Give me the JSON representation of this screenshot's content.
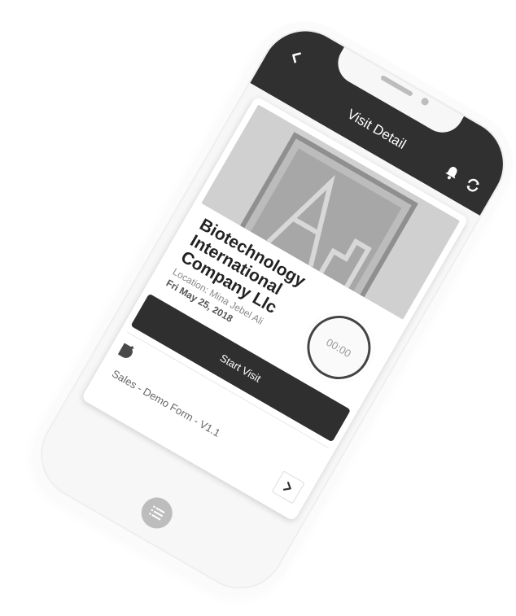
{
  "header": {
    "title": "Visit Detail",
    "back_icon": "chevron-left-icon",
    "bell_icon": "bell-icon",
    "refresh_icon": "refresh-icon"
  },
  "visit": {
    "company": "Biotechnology International Company Llc",
    "location": "Location: Mina Jebel Ali",
    "date": "Fri May 25, 2018",
    "timer": "00:00",
    "start_label": "Start Visit"
  },
  "form": {
    "name": "Sales - Demo Form - V1.1",
    "status_icon": "half-circle-status-icon",
    "open_icon": "chevron-right-icon"
  },
  "fab": {
    "icon": "list-icon"
  },
  "colors": {
    "header_bg": "#303030",
    "button_bg": "#2f2f2f",
    "screen_bg": "#f7f7f7",
    "fab_bg": "#bdbdbd"
  }
}
